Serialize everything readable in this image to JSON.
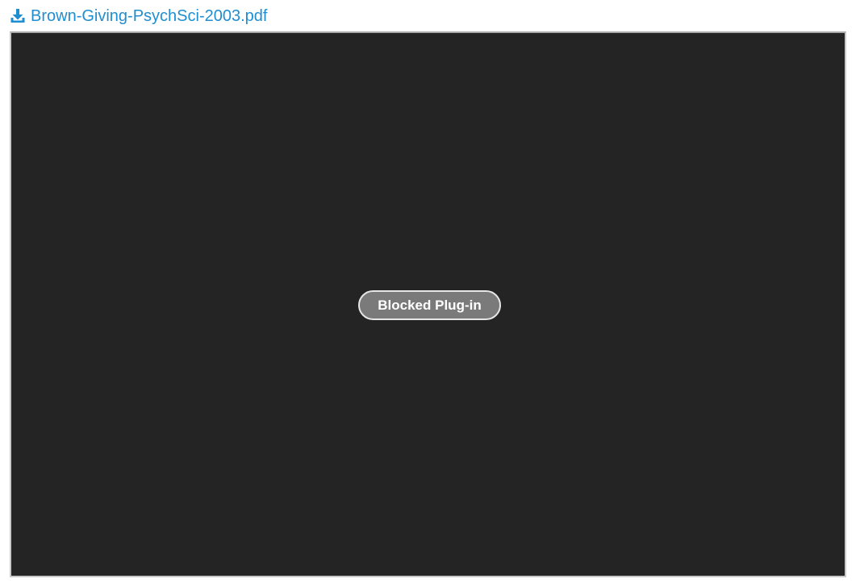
{
  "download": {
    "icon": "download-icon",
    "label": "Brown-Giving-PsychSci-2003.pdf",
    "color": "#1f8ed1"
  },
  "plugin": {
    "background": "#242424",
    "message": "Blocked Plug-in"
  }
}
